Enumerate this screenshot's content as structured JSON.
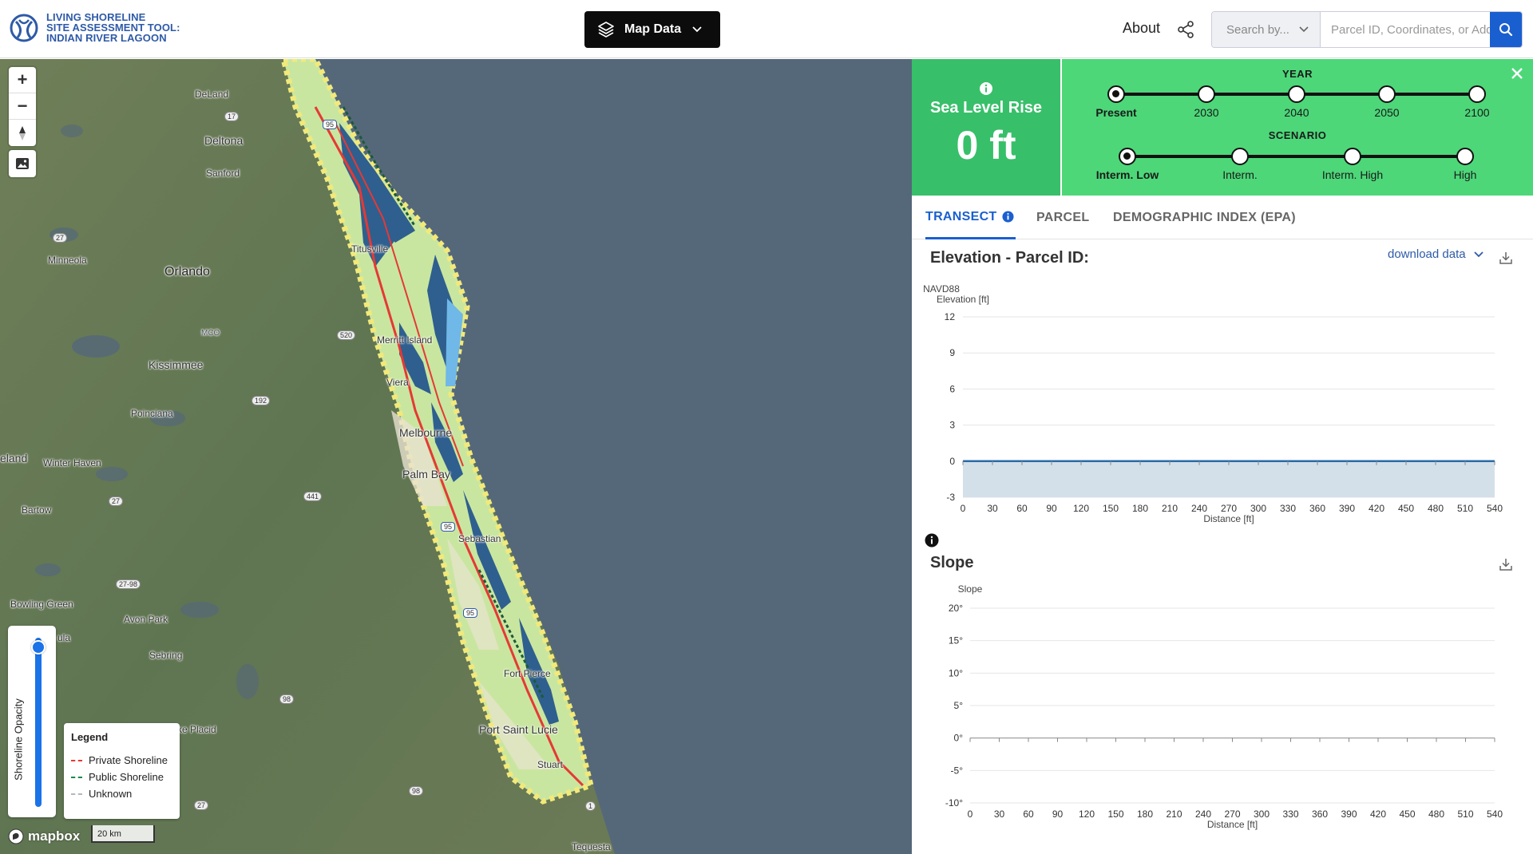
{
  "header": {
    "logo_line1": "LIVING SHORELINE",
    "logo_line2": "SITE ASSESSMENT TOOL:",
    "logo_line3": "INDIAN RIVER LAGOON",
    "map_data_label": "Map Data",
    "about_label": "About",
    "search_by_label": "Search by...",
    "search_placeholder": "Parcel ID, Coordinates, or Address"
  },
  "map": {
    "labels": {
      "deland": "DeLand",
      "deltona": "Deltona",
      "sanford": "Sanford",
      "minneola": "Minneola",
      "orlando": "Orlando",
      "titusville": "Titusville",
      "merritt_island": "Merritt Island",
      "kissimmee": "Kissimmee",
      "viera": "Viera",
      "poinciana": "Poinciana",
      "melbourne": "Melbourne",
      "palm_bay": "Palm Bay",
      "lakeland": "eland",
      "winter_haven": "Winter Haven",
      "bartow": "Bartow",
      "sebastian": "Sebastian",
      "bowling_green": "Bowling Green",
      "avon_park": "Avon Park",
      "sebring": "Sebring",
      "wauchula": "ula",
      "fort_pierce": "Fort Pierce",
      "lake_placid": "ke Placid",
      "port_saint_lucie": "Port Saint Lucie",
      "stuart": "Stuart",
      "tequesta": "Tequesta",
      "mco": "MCO"
    },
    "road_shields": {
      "i95_a": "95",
      "i95_b": "95",
      "i95_c": "95",
      "r27_a": "27",
      "r27_b": "27",
      "r27_c": "27",
      "r441": "441",
      "r192": "192",
      "r520": "520",
      "r27_98": "27-98",
      "r98_a": "98",
      "r98_b": "98",
      "r1": "1",
      "r17": "17"
    },
    "opacity_label": "Shoreline Opacity",
    "opacity_value": 0.97,
    "legend": {
      "title": "Legend",
      "items": [
        {
          "label": "Private Shoreline",
          "color": "#e53935"
        },
        {
          "label": "Public Shoreline",
          "color": "#1b8a4a"
        },
        {
          "label": "Unknown",
          "color": "#b0b8c4"
        }
      ]
    },
    "mapbox_label": "mapbox",
    "scale_label": "20 km"
  },
  "panel": {
    "slr_title": "Sea Level Rise",
    "slr_value": "0 ft",
    "year_title": "YEAR",
    "years": [
      "Present",
      "2030",
      "2040",
      "2050",
      "2100"
    ],
    "year_selected": 0,
    "scenario_title": "SCENARIO",
    "scenarios": [
      "Interm. Low",
      "Interm.",
      "Interm. High",
      "High"
    ],
    "scenario_selected": 0,
    "tabs": [
      "TRANSECT",
      "PARCEL",
      "DEMOGRAPHIC INDEX (EPA)"
    ],
    "active_tab": 0,
    "download_label": "download data",
    "elevation_title": "Elevation - Parcel ID:",
    "slope_title": "Slope"
  },
  "chart_data": [
    {
      "type": "area",
      "title": "Elevation - Parcel ID:",
      "ylabel_line1": "NAVD88",
      "ylabel_line2": "Elevation [ft]",
      "xlabel": "Distance [ft]",
      "x_ticks": [
        0,
        30,
        60,
        90,
        120,
        150,
        180,
        210,
        240,
        270,
        300,
        330,
        360,
        390,
        420,
        450,
        480,
        510,
        540
      ],
      "y_ticks": [
        12,
        9,
        6,
        3,
        0,
        -3
      ],
      "ylim": [
        -3,
        12
      ],
      "xlim": [
        0,
        540
      ],
      "grid": true,
      "series": [
        {
          "x": [
            0,
            540
          ],
          "values": [
            0,
            0
          ],
          "color": "#2a6aa8",
          "fill": "#d3e0ea"
        }
      ]
    },
    {
      "type": "line",
      "title": "Slope",
      "ylabel": "Slope",
      "xlabel": "Distance [ft]",
      "x_ticks": [
        0,
        30,
        60,
        90,
        120,
        150,
        180,
        210,
        240,
        270,
        300,
        330,
        360,
        390,
        420,
        450,
        480,
        510,
        540
      ],
      "y_ticks": [
        "20°",
        "15°",
        "10°",
        "5°",
        "0°",
        "-5°",
        "-10°"
      ],
      "y_tick_values": [
        20,
        15,
        10,
        5,
        0,
        -5,
        -10
      ],
      "ylim": [
        -10,
        20
      ],
      "xlim": [
        0,
        540
      ],
      "grid": true,
      "series": []
    }
  ]
}
